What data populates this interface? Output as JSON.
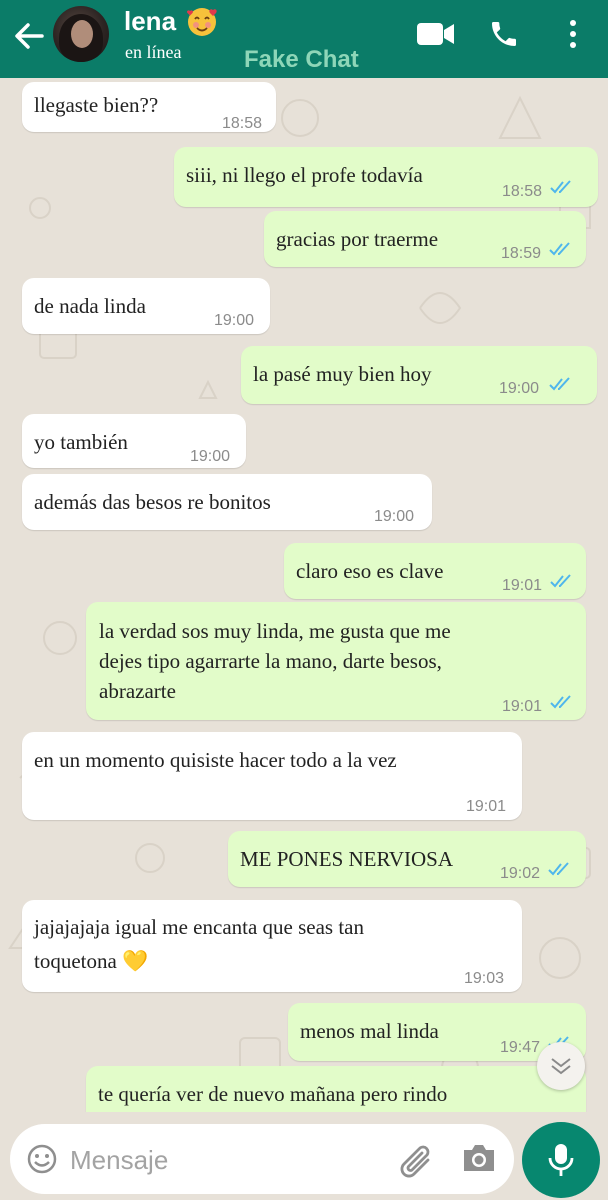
{
  "header": {
    "contact_name": "lena",
    "status": "en línea",
    "watermark": "Fake Chat"
  },
  "messages": [
    {
      "dir": "in",
      "text": "llegaste bien??",
      "time": "18:58"
    },
    {
      "dir": "out",
      "text": "siii, ni llego el profe todavía",
      "time": "18:58",
      "read": true
    },
    {
      "dir": "out",
      "text": "gracias por traerme",
      "time": "18:59",
      "read": true
    },
    {
      "dir": "in",
      "text": "de nada linda",
      "time": "19:00"
    },
    {
      "dir": "out",
      "text": "la pasé muy bien hoy",
      "time": "19:00",
      "read": true
    },
    {
      "dir": "in",
      "text": "yo también",
      "time": "19:00"
    },
    {
      "dir": "in",
      "text": "además das besos re bonitos",
      "time": "19:00"
    },
    {
      "dir": "out",
      "text": "claro eso es clave",
      "time": "19:01",
      "read": true
    },
    {
      "dir": "out",
      "lines": [
        "la verdad sos muy linda, me gusta que me",
        "dejes tipo agarrarte la mano, darte besos,",
        "abrazarte"
      ],
      "time": "19:01",
      "read": true
    },
    {
      "dir": "in",
      "text": "en un momento quisiste hacer todo a la vez",
      "time": "19:01"
    },
    {
      "dir": "out",
      "text": "ME PONES NERVIOSA",
      "time": "19:02",
      "read": true
    },
    {
      "dir": "in",
      "lines": [
        "jajajajaja igual me encanta que seas tan",
        "toquetona 💛"
      ],
      "time": "19:03"
    },
    {
      "dir": "out",
      "text": "menos mal linda",
      "time": "19:47",
      "read": true
    },
    {
      "dir": "out",
      "text": "te quería ver de nuevo mañana pero rindo",
      "time": ""
    }
  ],
  "composer": {
    "placeholder": "Mensaje"
  },
  "colors": {
    "header": "#0b7c68",
    "outgoing_bubble": "#e2fcc9",
    "incoming_bubble": "#ffffff",
    "read_ticks": "#4fb6ec",
    "mic_button": "#07876f"
  },
  "icons": [
    "back-arrow-icon",
    "video-call-icon",
    "phone-icon",
    "more-vert-icon",
    "emoji-icon",
    "attach-icon",
    "camera-icon",
    "mic-icon",
    "scroll-down-icon"
  ]
}
